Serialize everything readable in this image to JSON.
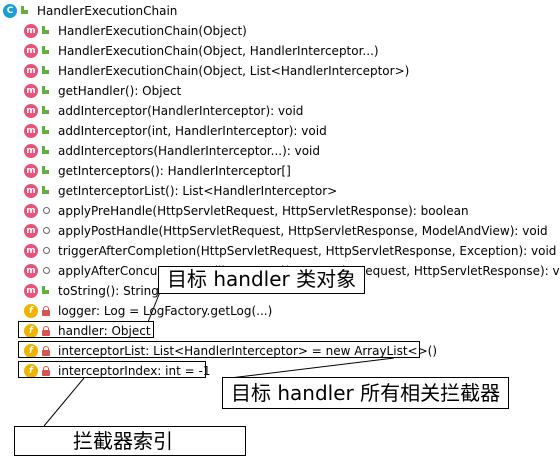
{
  "class_header": {
    "name": "HandlerExecutionChain",
    "icon": "class-icon"
  },
  "members": [
    {
      "kind": "m",
      "mod": "pub",
      "text": "HandlerExecutionChain(Object)"
    },
    {
      "kind": "m",
      "mod": "pub",
      "text": "HandlerExecutionChain(Object, HandlerInterceptor...)"
    },
    {
      "kind": "m",
      "mod": "pub",
      "text": "HandlerExecutionChain(Object, List<HandlerInterceptor>)"
    },
    {
      "kind": "m",
      "mod": "pub",
      "text": "getHandler(): Object"
    },
    {
      "kind": "m",
      "mod": "pub",
      "text": "addInterceptor(HandlerInterceptor): void"
    },
    {
      "kind": "m",
      "mod": "pub",
      "text": "addInterceptor(int, HandlerInterceptor): void"
    },
    {
      "kind": "m",
      "mod": "pub",
      "text": "addInterceptors(HandlerInterceptor...): void"
    },
    {
      "kind": "m",
      "mod": "pub",
      "text": "getInterceptors(): HandlerInterceptor[]"
    },
    {
      "kind": "m",
      "mod": "pub",
      "text": "getInterceptorList(): List<HandlerInterceptor>"
    },
    {
      "kind": "m",
      "mod": "pkg",
      "text": "applyPreHandle(HttpServletRequest, HttpServletResponse): boolean"
    },
    {
      "kind": "m",
      "mod": "pkg",
      "text": "applyPostHandle(HttpServletRequest, HttpServletResponse, ModelAndView): void"
    },
    {
      "kind": "m",
      "mod": "pkg",
      "text": "triggerAfterCompletion(HttpServletRequest, HttpServletResponse, Exception): void"
    },
    {
      "kind": "m",
      "mod": "pkg",
      "text": "applyAfterConcurrentHandlingStarted(HttpServletRequest, HttpServletResponse): void"
    },
    {
      "kind": "m",
      "mod": "pub",
      "text": "toString(): String"
    },
    {
      "kind": "f",
      "mod": "priv",
      "text": "logger: Log = LogFactory.getLog(...)"
    },
    {
      "kind": "f",
      "mod": "priv",
      "text": "handler: Object"
    },
    {
      "kind": "f",
      "mod": "priv",
      "text": "interceptorList: List<HandlerInterceptor> = new ArrayList<>()"
    },
    {
      "kind": "f",
      "mod": "priv",
      "text": "interceptorIndex: int = -1"
    }
  ],
  "callouts": {
    "handler": "目标 handler 类对象",
    "interceptor_list": "目标 handler 所有相关拦截器",
    "interceptor_index": "拦截器索引"
  },
  "colors": {
    "method_icon": "#e8537a",
    "field_icon": "#f0b400",
    "class_icon": "#1aa0d8",
    "public_mod": "#5fb03c",
    "private_mod": "#d9534f"
  }
}
